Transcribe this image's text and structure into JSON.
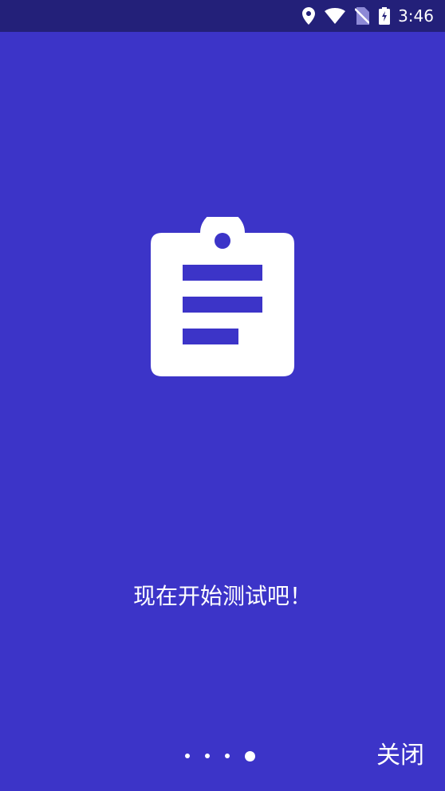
{
  "status_bar": {
    "time": "3:46",
    "icons": [
      "location-icon",
      "wifi-icon",
      "no-sim-icon",
      "battery-charging-icon"
    ]
  },
  "hero": {
    "icon": "clipboard-icon"
  },
  "content": {
    "message": "现在开始测试吧！"
  },
  "pager": {
    "total_pages": 4,
    "current_page": 4
  },
  "footer": {
    "close_label": "关闭"
  },
  "colors": {
    "background": "#3c34c8",
    "status_bar": "#232079",
    "foreground": "#ffffff"
  }
}
